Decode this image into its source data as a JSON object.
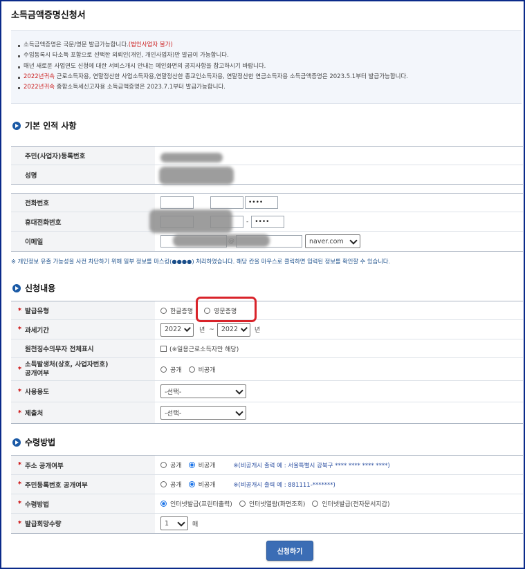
{
  "page": {
    "title": "소득금액증명신청서"
  },
  "notice": {
    "items": [
      {
        "text": "소득금액증명은 국문/영문 발급가능합니다.",
        "red": "(법인사업자 불가)"
      },
      {
        "text": "수임동록시 타소득 포함으로 선택한 외뢰인(개인, 개인사업자)만 발급이 가능합니다.",
        "red": ""
      },
      {
        "text": "매년 새로운 사업연도 신청에 대한 서비스개시 안내는 메인화면의 공지사항을 참고하시기 바랍니다.",
        "red": ""
      },
      {
        "red": "2022년귀속",
        "text": " 근로소득자용, 연말정산한 사업소득자용,연말정산한 종교인소득자용, 연말정산한 연금소득자용 소득금액증명은 2023.5.1부터 발급가능합니다."
      },
      {
        "red": "2022년귀속",
        "text": " 종합소득세신고자용 소득금액증명은 2023.7.1부터 발급가능합니다."
      }
    ]
  },
  "basic": {
    "heading": "기본 인적 사항",
    "resident_label": "주민(사업자)등록번호",
    "name_label": "성명",
    "phone_label": "전화번호",
    "phone_last": "••••",
    "mobile_label": "휴대전화번호",
    "mobile_last": "••••",
    "dash": "-",
    "email_label": "이메일",
    "email_at": "@",
    "email_domain": "naver.com",
    "masking_note": "※ 개인정보 유출 가능성을 사전 차단하기 위해 일부 정보를 마스킹(●●●●) 처리하였습니다. 해당 칸을 마우스로 클릭하면 입력된 정보를 확인할 수 있습니다."
  },
  "apply": {
    "heading": "신청내용",
    "issue_type_label": "발급유형",
    "issue_korean": "한글증명",
    "issue_english": "영문증명",
    "tax_period_label": "과세기간",
    "year_from": "2022",
    "year_to": "2022",
    "year_unit": "년",
    "tilde": "~",
    "withholding_label": "원천징수의무자 전체표시",
    "withholding_hint": "(※일용근로소득자만 해당)",
    "disclose_label_1": "소득발생처(상호, 사업자번호)",
    "disclose_label_2": "공개여부",
    "public": "공개",
    "private": "비공개",
    "usage_label": "사용용도",
    "usage_value": "-선택-",
    "submit_to_label": "제출처",
    "submit_to_value": "-선택-"
  },
  "receive": {
    "heading": "수령방법",
    "addr_label": "주소 공개여부",
    "addr_hint": "※(비공개시 출력 예 : 서울특별시 강북구 **** **** **** ****)",
    "rrn_label": "주민등록번호 공개여부",
    "rrn_hint": "※(비공개시 출력 예 : 881111-*******)",
    "method_label": "수령방법",
    "method_print": "인터넷발급(프린터출력)",
    "method_view": "인터넷열람(화면조회)",
    "method_edoc": "인터넷발급(전자문서지갑)",
    "count_label": "발급회망수량",
    "count_value": "1",
    "count_unit": "매"
  },
  "submit": {
    "label": "신청하기"
  },
  "colors": {
    "accent": "#1b5aa6",
    "required": "#c00000",
    "highlight": "#d9232a",
    "button": "#3b6db5"
  }
}
